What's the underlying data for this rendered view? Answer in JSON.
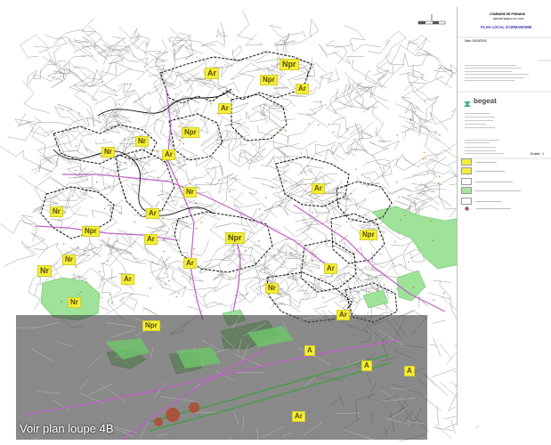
{
  "cartouche": {
    "commune": "COMMUNE DE PIGNANS",
    "departement": "DEPARTEMENT DU VAR",
    "title": "PLAN LOCAL D'URBANISME",
    "date": "Date: 26/03/2018",
    "firm": "begeat",
    "echelle": "Echelle : 1"
  },
  "legend": {
    "items": [
      {
        "color": "#f2ee3a"
      },
      {
        "color": "#f2ee3a"
      },
      {
        "color": "#ffffff"
      },
      {
        "color": "#a8e6a0"
      },
      {
        "color": "#ffffff"
      },
      {
        "color": "#d04040"
      }
    ]
  },
  "zones": [
    {
      "label": "Npr"
    },
    {
      "label": "Npr"
    },
    {
      "label": "Ar"
    },
    {
      "label": "Ar"
    },
    {
      "label": "Ar"
    },
    {
      "label": "Npr"
    },
    {
      "label": "Nr"
    },
    {
      "label": "Nr"
    },
    {
      "label": "Ar"
    },
    {
      "label": "Nr"
    },
    {
      "label": "Nr"
    },
    {
      "label": "Nr"
    },
    {
      "label": "Ar"
    },
    {
      "label": "Ar"
    },
    {
      "label": "Nr"
    },
    {
      "label": "Npr"
    },
    {
      "label": "Npr"
    },
    {
      "label": "Npr"
    },
    {
      "label": "Ar"
    },
    {
      "label": "Ar"
    },
    {
      "label": "Ar"
    },
    {
      "label": "Nr"
    },
    {
      "label": "Ar"
    },
    {
      "label": "Ar"
    },
    {
      "label": "Nr"
    },
    {
      "label": "Nr"
    },
    {
      "label": "Npr"
    },
    {
      "label": "Ar"
    },
    {
      "label": "Ar"
    },
    {
      "label": "Ar"
    },
    {
      "label": "A"
    },
    {
      "label": "A"
    },
    {
      "label": "A"
    },
    {
      "label": "A"
    },
    {
      "label": "Nr"
    },
    {
      "label": "Ar"
    },
    {
      "label": "Ar"
    }
  ],
  "loupe": {
    "label": "Voir plan loupe 4B"
  }
}
